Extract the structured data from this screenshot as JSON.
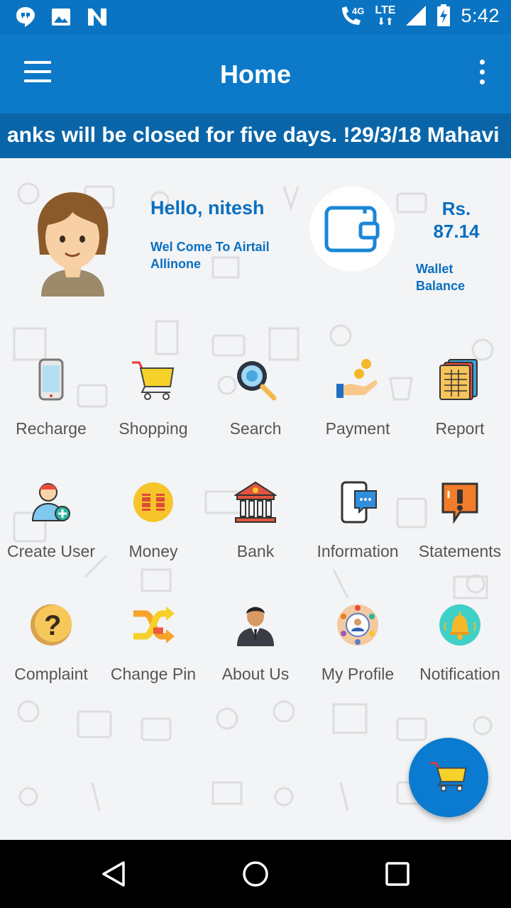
{
  "status_bar": {
    "time": "5:42",
    "network_type": "4G",
    "lte": "LTE",
    "icons": [
      "hangouts-icon",
      "image-icon",
      "n-icon",
      "wifi-call-icon",
      "signal-icon",
      "battery-charging-icon"
    ]
  },
  "app_bar": {
    "title": "Home",
    "menu_icon": "hamburger-menu-icon",
    "more_icon": "more-vert-icon"
  },
  "ticker": {
    "text": "anks will be closed for five days. !29/3/18 Mahavi"
  },
  "profile": {
    "greeting": "Hello, nitesh",
    "welcome": "Wel Come To Airtail Allinone",
    "balance_currency": "Rs.",
    "balance_amount": "87.14",
    "wallet_label": "Wallet Balance"
  },
  "grid": [
    {
      "label": "Recharge",
      "icon": "mobile-phone-icon"
    },
    {
      "label": "Shopping",
      "icon": "shopping-cart-icon"
    },
    {
      "label": "Search",
      "icon": "magnifier-icon"
    },
    {
      "label": "Payment",
      "icon": "hand-coins-icon"
    },
    {
      "label": "Report",
      "icon": "report-sheets-icon"
    },
    {
      "label": "Create User",
      "icon": "add-user-icon"
    },
    {
      "label": "Money",
      "icon": "money-coin-icon"
    },
    {
      "label": "Bank",
      "icon": "bank-building-icon"
    },
    {
      "label": "Information",
      "icon": "phone-chat-icon"
    },
    {
      "label": "Statements",
      "icon": "alert-bubble-icon"
    },
    {
      "label": "Complaint",
      "icon": "question-icon"
    },
    {
      "label": "Change Pin",
      "icon": "shuffle-arrows-icon"
    },
    {
      "label": "About Us",
      "icon": "businessman-icon"
    },
    {
      "label": "My Profile",
      "icon": "network-profile-icon"
    },
    {
      "label": "Notification",
      "icon": "bell-icon"
    }
  ],
  "colors": {
    "primary": "#0c7ac8",
    "ticker_bg": "#0a65a8",
    "accent_text": "#0a6fbf",
    "fab": "#0a7bd0"
  }
}
